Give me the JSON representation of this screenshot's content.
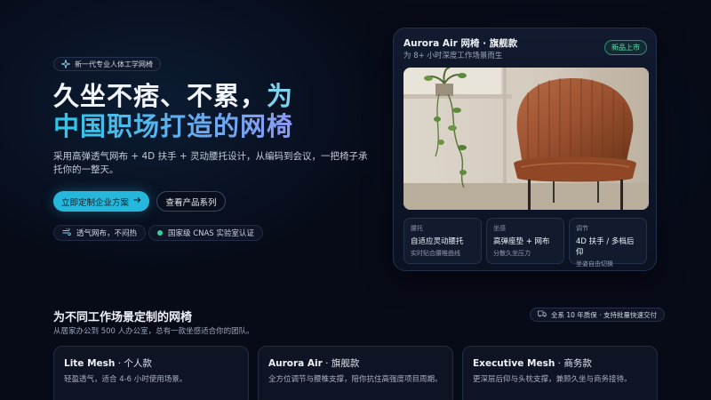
{
  "colors": {
    "background": "#070b18",
    "accent": "#25b8dc",
    "success": "#35d29a"
  },
  "hero": {
    "eyebrow": "新一代专业人体工学网椅",
    "eyebrow_icon": "sparkle-icon",
    "title_line1": "久坐不痞、不累，",
    "title_line1_accent": "为",
    "title_line2": "中国职场打造的网椅",
    "description": "采用高弹透气网布 + 4D 扶手 + 灵动腰托设计，从编码到会议，一把椅子承托你的一整天。",
    "primary_button": "立即定制企业方案",
    "primary_button_icon": "arrow-right-icon",
    "secondary_button": "查看产品系列",
    "chips": [
      {
        "label": "透气网布，不闷热",
        "icon": "wind-icon"
      },
      {
        "label": "国家级 CNAS 实验室认证",
        "icon": "status-dot-icon"
      }
    ]
  },
  "product_card": {
    "title": "Aurora Air 网椅 · 旗舰款",
    "subtitle": "为 8+ 小时深度工作场景而生",
    "badge": "新品上市",
    "image_subject": "leather-armchair-photo",
    "specs": [
      {
        "key": "腰托",
        "value": "自适应灵动腰托",
        "note": "实时贴合腰椎曲线"
      },
      {
        "key": "坐感",
        "value": "高弹座垫 + 网布",
        "note": "分散久坐压力"
      },
      {
        "key": "调节",
        "value": "4D 扶手 / 多档后仰",
        "note": "坐姿自由切换"
      }
    ]
  },
  "section": {
    "title": "为不同工作场景定制的网椅",
    "subtitle": "从居家办公到 500 人办公室，总有一款坐感适合你的团队。",
    "badge": "全系 10 年质保 · 支持批量快速交付",
    "badge_icon": "truck-icon",
    "plans": [
      {
        "name": "Lite Mesh",
        "tier": " · 个人款",
        "description": "轻盈透气，适合 4-6 小时使用场景。"
      },
      {
        "name": "Aurora Air",
        "tier": " · 旗舰款",
        "description": "全方位调节与腰椎支撑，陪你抗住高强度项目周期。"
      },
      {
        "name": "Executive Mesh",
        "tier": " · 商务款",
        "description": "更深层后仰与头枕支撑，兼顾久坐与商务接待。"
      }
    ]
  }
}
